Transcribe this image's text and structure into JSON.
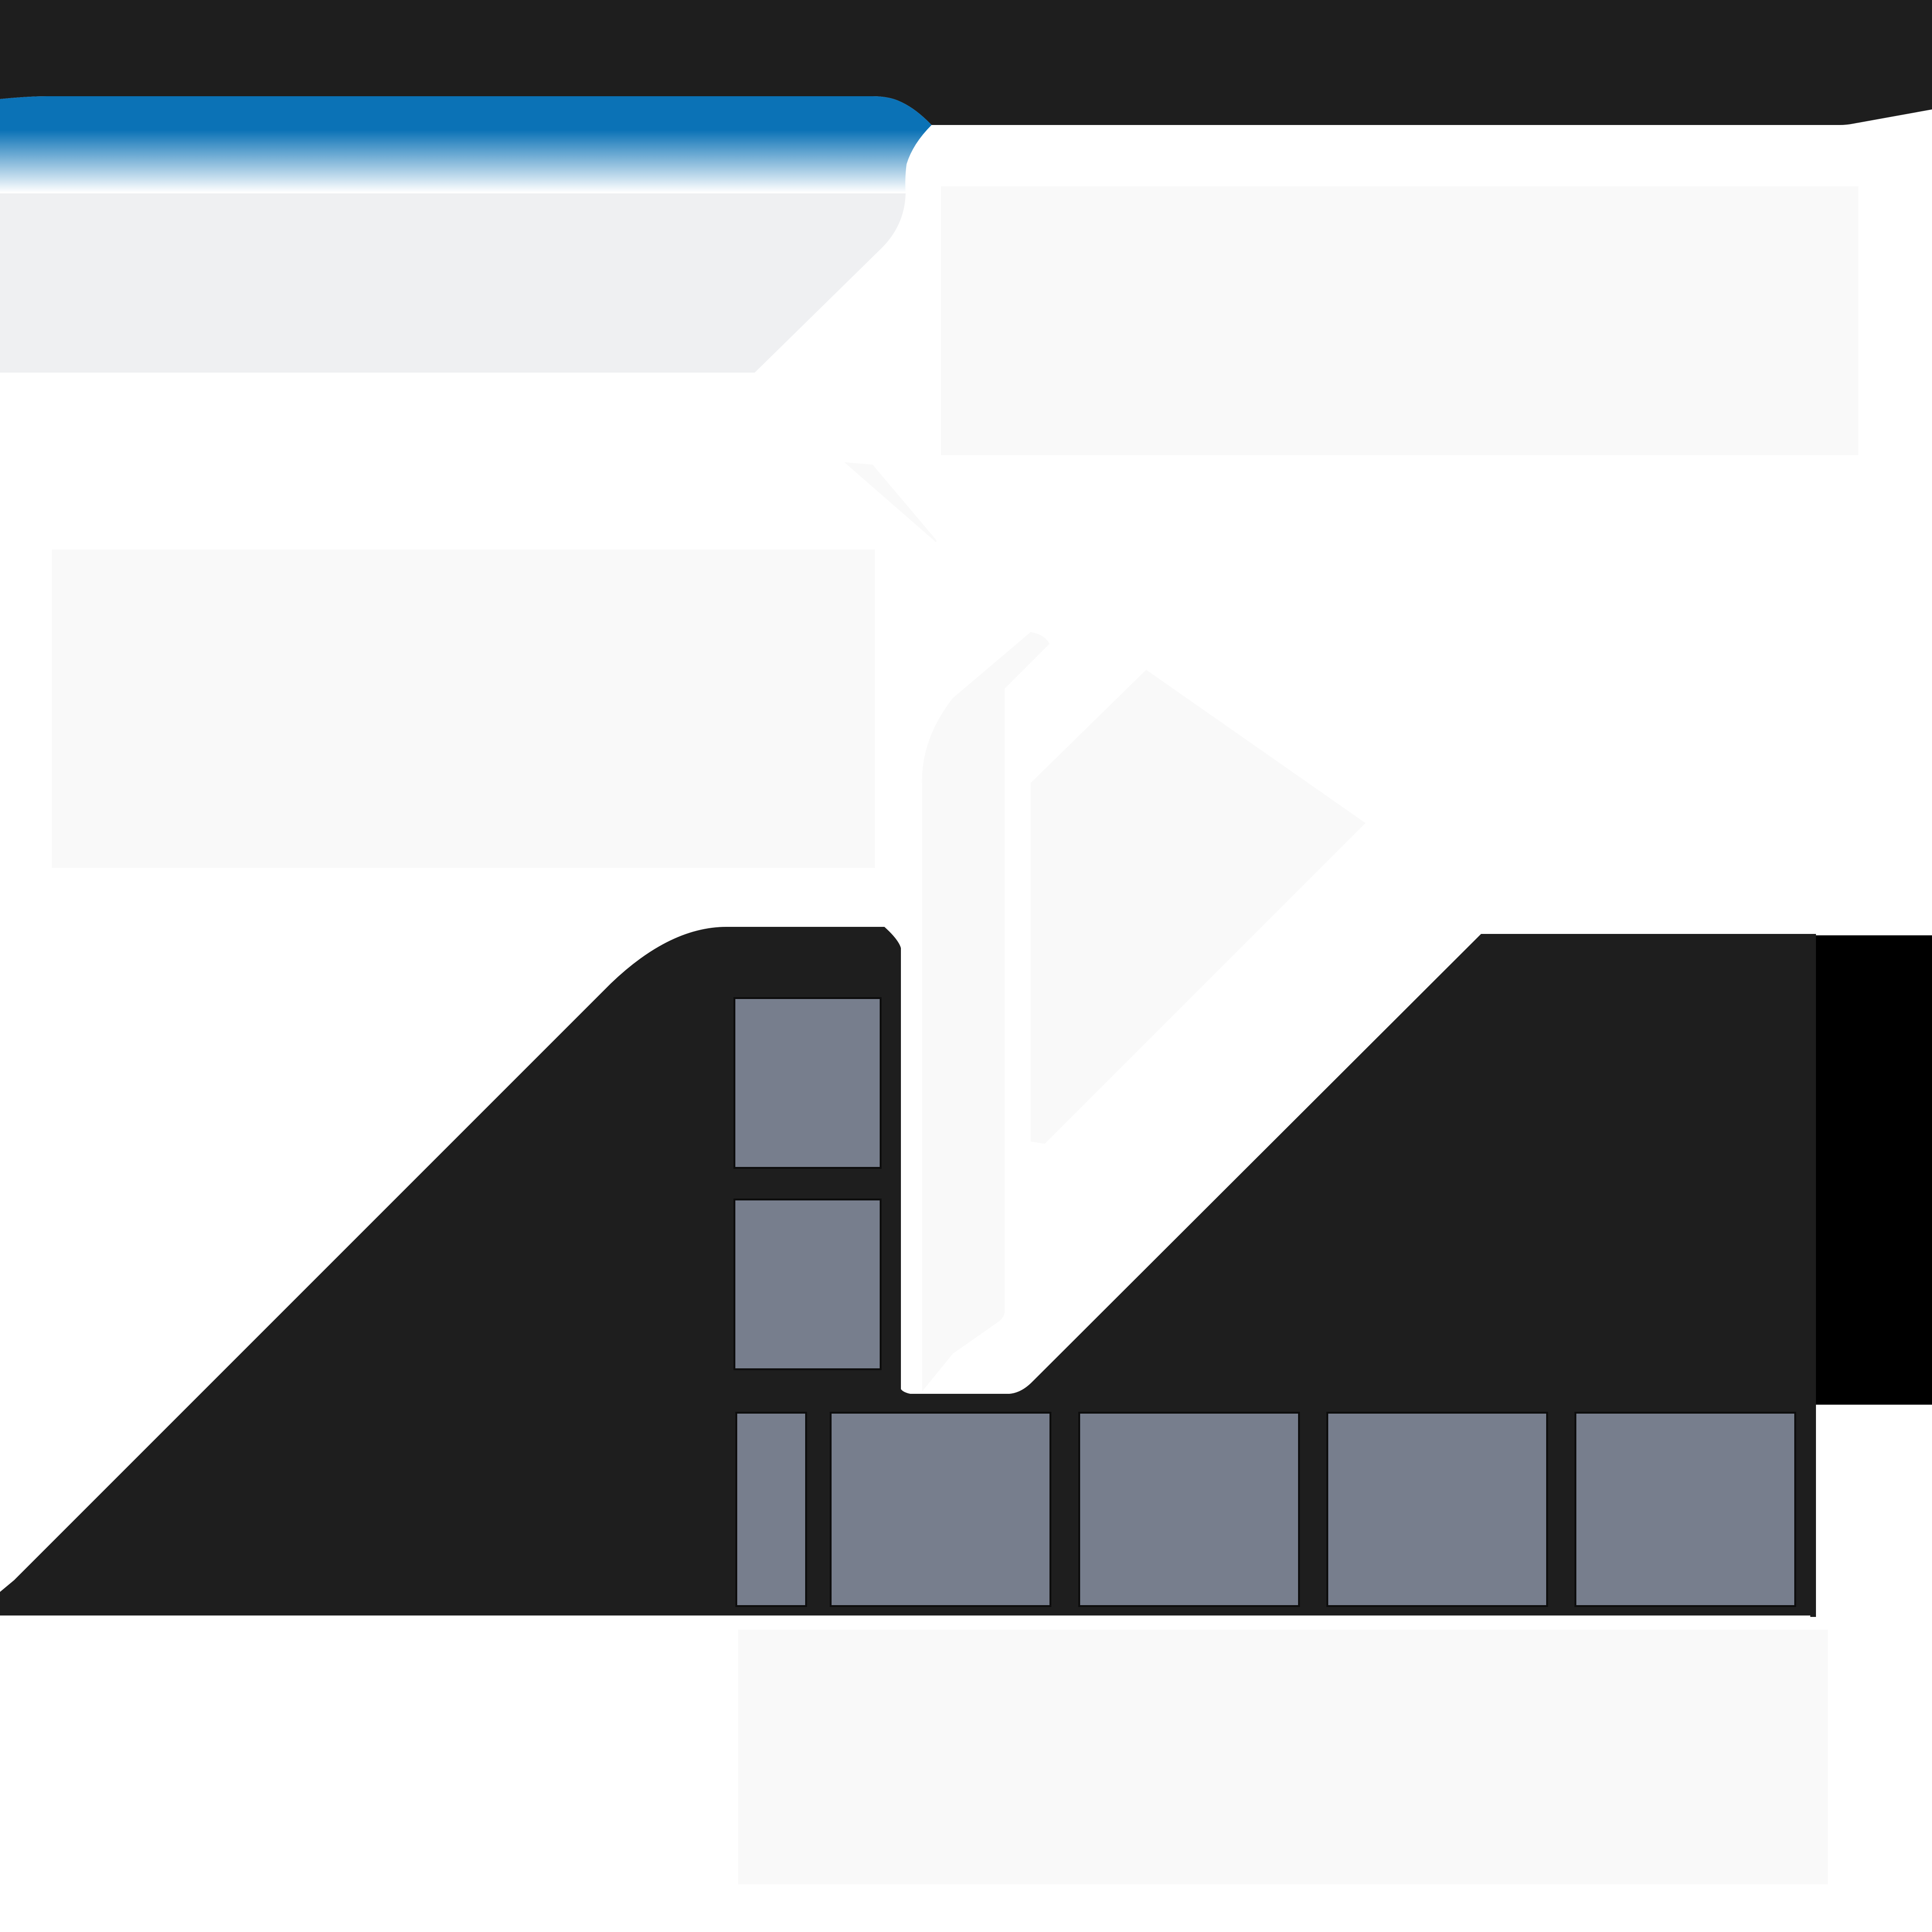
{
  "colors": {
    "page_background": "#ffffff",
    "top_bar": "#1e1e1e",
    "header_blue": "#0b72b6",
    "header_fade": "#ffffff",
    "header_panel": "#eff0f2",
    "faded_block": "#f9f9f9",
    "dark_panel": "#1e1e1e",
    "black_block": "#000000",
    "tile_fill": "#777e8d",
    "tile_border": "#0d0d0d"
  },
  "tiles": {
    "column": [
      {
        "name": "tile-column-1"
      },
      {
        "name": "tile-column-2"
      }
    ],
    "row": [
      {
        "name": "tile-row-1"
      },
      {
        "name": "tile-row-2"
      },
      {
        "name": "tile-row-3"
      },
      {
        "name": "tile-row-4"
      },
      {
        "name": "tile-row-5"
      }
    ]
  }
}
